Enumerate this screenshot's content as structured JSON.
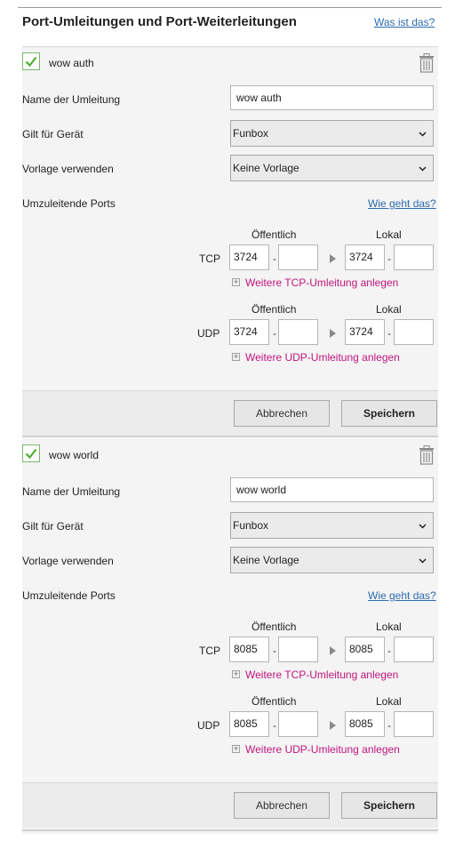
{
  "header": {
    "title": "Port-Umleitungen und Port-Weiterleitungen",
    "help_link": "Was ist das?"
  },
  "labels": {
    "name": "Name der Umleitung",
    "device": "Gilt für Gerät",
    "template": "Vorlage verwenden",
    "ports": "Umzuleitende Ports",
    "how_link": "Wie geht das?",
    "public": "Öffentlich",
    "local": "Lokal",
    "tcp": "TCP",
    "udp": "UDP",
    "dash": "-",
    "add_tcp": "Weitere TCP-Umleitung anlegen",
    "add_udp": "Weitere UDP-Umleitung anlegen",
    "plus": "+",
    "cancel": "Abbrechen",
    "save": "Speichern"
  },
  "rules": [
    {
      "enabled": true,
      "title": "wow auth",
      "name_value": "wow auth",
      "device": "Funbox",
      "template": "Keine Vorlage",
      "tcp": {
        "public_from": "3724",
        "public_to": "",
        "local_from": "3724",
        "local_to": ""
      },
      "udp": {
        "public_from": "3724",
        "public_to": "",
        "local_from": "3724",
        "local_to": ""
      }
    },
    {
      "enabled": true,
      "title": "wow world",
      "name_value": "wow world",
      "device": "Funbox",
      "template": "Keine Vorlage",
      "tcp": {
        "public_from": "8085",
        "public_to": "",
        "local_from": "8085",
        "local_to": ""
      },
      "udp": {
        "public_from": "8085",
        "public_to": "",
        "local_from": "8085",
        "local_to": ""
      }
    }
  ],
  "colors": {
    "link": "#2b6cb0",
    "add_link": "#c0157e",
    "checkbox_green": "#4caf2f",
    "panel_bg": "#f4f4f4"
  }
}
